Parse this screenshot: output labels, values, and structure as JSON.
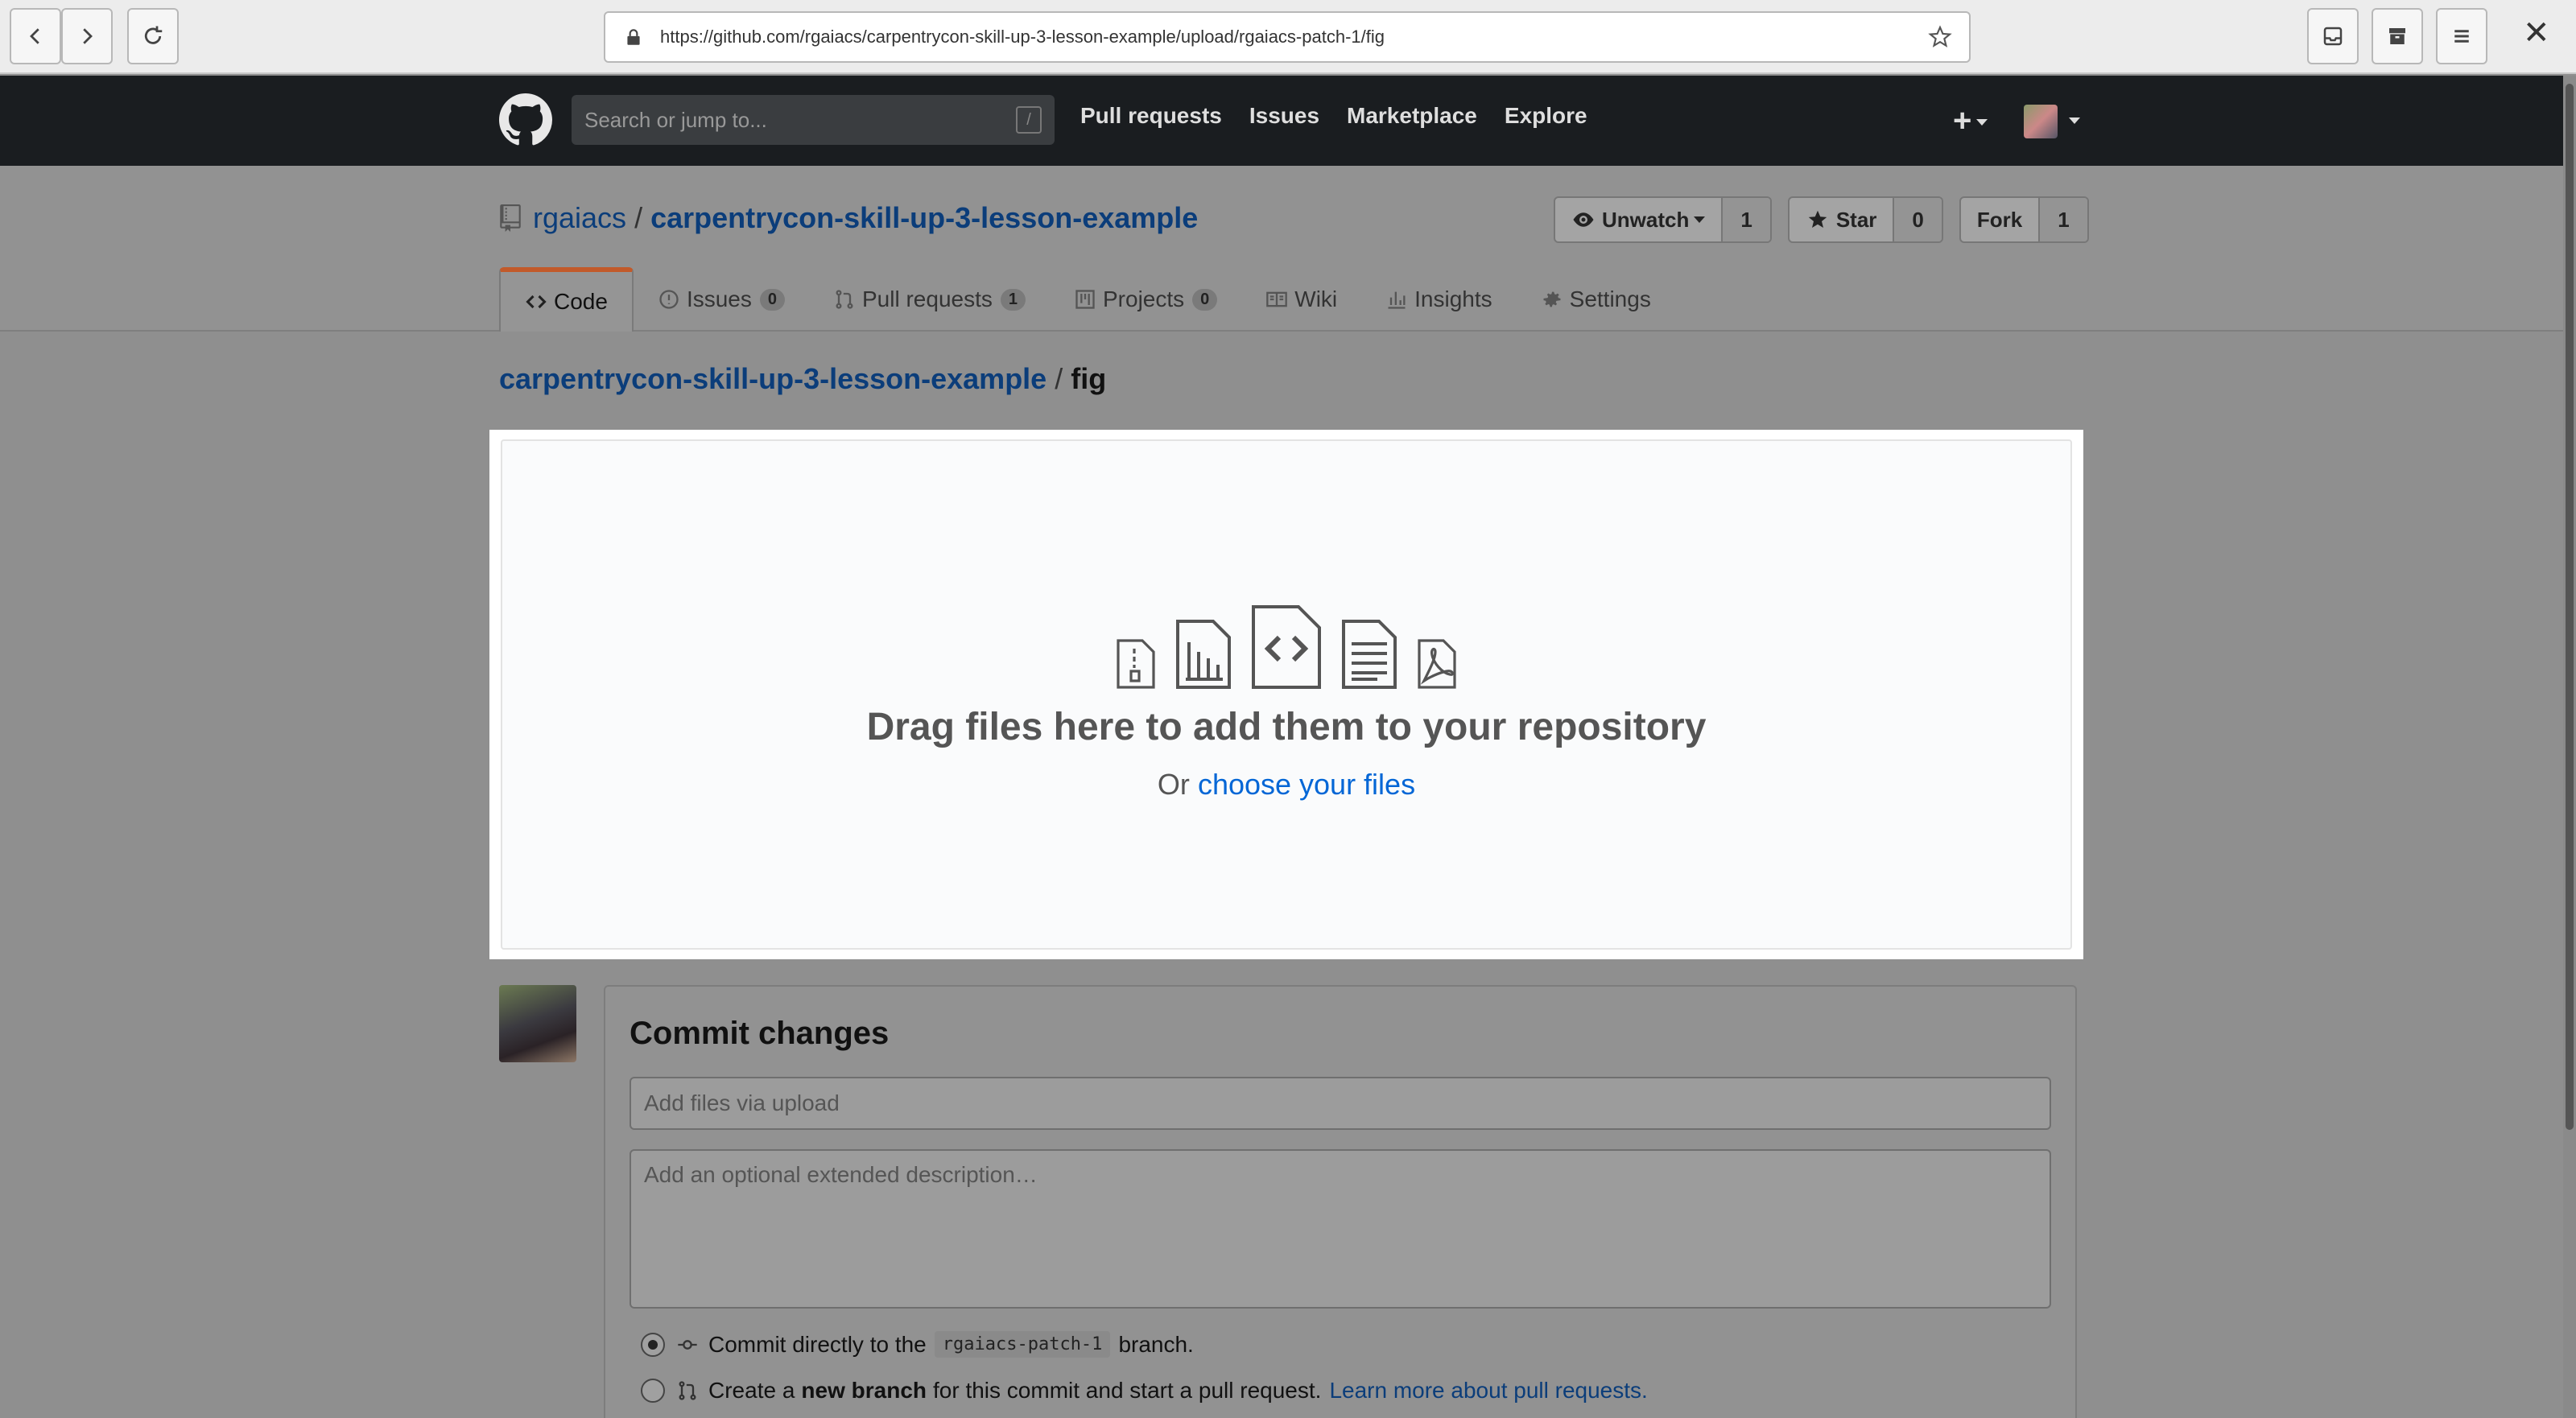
{
  "browser": {
    "url": "https://github.com/rgaiacs/carpentrycon-skill-up-3-lesson-example/upload/rgaiacs-patch-1/fig",
    "close_label": "✕"
  },
  "header": {
    "search_placeholder": "Search or jump to...",
    "slash_key": "/",
    "nav": [
      "Pull requests",
      "Issues",
      "Marketplace",
      "Explore"
    ],
    "plus_label": "+"
  },
  "repo": {
    "owner": "rgaiacs",
    "separator": "/",
    "name": "carpentrycon-skill-up-3-lesson-example",
    "watch_label": "Unwatch",
    "watch_count": "1",
    "star_label": "Star",
    "star_count": "0",
    "fork_label": "Fork",
    "fork_count": "1"
  },
  "tabs": [
    {
      "label": "Code",
      "count": null
    },
    {
      "label": "Issues",
      "count": "0"
    },
    {
      "label": "Pull requests",
      "count": "1"
    },
    {
      "label": "Projects",
      "count": "0"
    },
    {
      "label": "Wiki",
      "count": null
    },
    {
      "label": "Insights",
      "count": null
    },
    {
      "label": "Settings",
      "count": null
    }
  ],
  "breadcrumb": {
    "repo": "carpentrycon-skill-up-3-lesson-example",
    "separator": "/",
    "current": "fig"
  },
  "dropzone": {
    "title": "Drag files here to add them to your repository",
    "or_text": "Or",
    "choose_link": "choose your files"
  },
  "commit": {
    "title": "Commit changes",
    "message_placeholder": "Add files via upload",
    "description_placeholder": "Add an optional extended description…",
    "option1_prefix": "Commit directly to the",
    "option1_branch": "rgaiacs-patch-1",
    "option1_suffix": "branch.",
    "option2_prefix": "Create a",
    "option2_bold": "new branch",
    "option2_suffix": "for this commit and start a pull request.",
    "option2_link": "Learn more about pull requests."
  },
  "colors": {
    "link": "#0366d6",
    "header_bg": "#1a1d20",
    "active_tab_accent": "#c25a2a"
  }
}
